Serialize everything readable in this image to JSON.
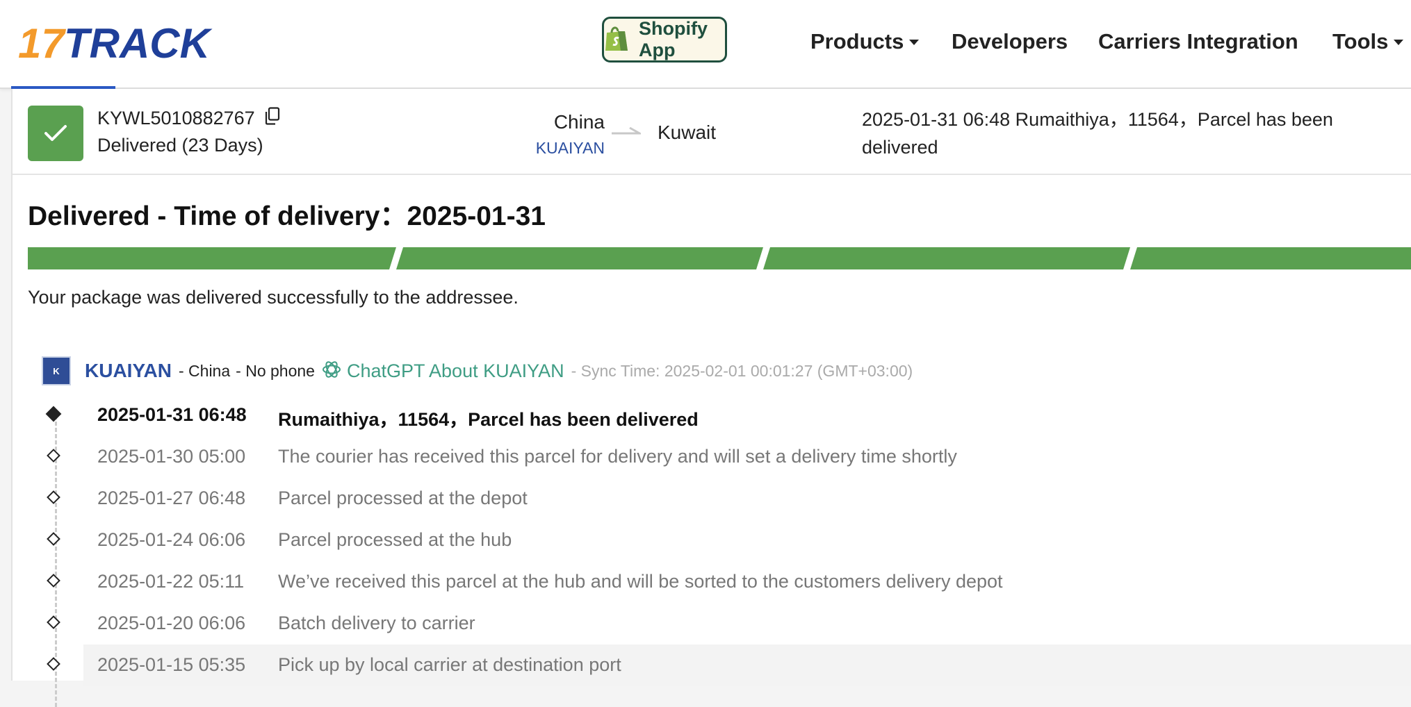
{
  "brand": {
    "logo_prefix": "17",
    "logo_suffix": "TRACK",
    "accent": "#2b4fa0",
    "orange": "#f39a2b"
  },
  "nav": {
    "shopify_label": "Shopify App",
    "items": [
      {
        "label": "Products",
        "dropdown": true
      },
      {
        "label": "Developers",
        "dropdown": false
      },
      {
        "label": "Carriers Integration",
        "dropdown": false
      },
      {
        "label": "Tools",
        "dropdown": true
      }
    ]
  },
  "summary": {
    "tracking_number": "KYWL5010882767",
    "status_days": "Delivered (23 Days)",
    "origin": "China",
    "carrier": "KUAIYAN",
    "destination": "Kuwait",
    "latest_event": "2025-01-31 06:48  Rumaithiya，11564，Parcel has been delivered",
    "status_color": "#5aa050"
  },
  "delivery": {
    "title": "Delivered - Time of delivery：2025-01-31",
    "message": "Your package was delivered successfully to the addressee.",
    "progress_segments_completed": 4,
    "progress_color": "#5aa050"
  },
  "carrier_info": {
    "name": "KUAIYAN",
    "country": "- China",
    "phone": "- No phone",
    "chatgpt_label": "ChatGPT About KUAIYAN",
    "sync_time": "- Sync Time: 2025-02-01 00:01:27 (GMT+03:00)"
  },
  "events": [
    {
      "time": "2025-01-31 06:48",
      "desc": "Rumaithiya，11564，Parcel has been delivered"
    },
    {
      "time": "2025-01-30 05:00",
      "desc": "The courier has received this parcel for delivery and will set a delivery time shortly"
    },
    {
      "time": "2025-01-27 06:48",
      "desc": "Parcel processed at the depot"
    },
    {
      "time": "2025-01-24 06:06",
      "desc": "Parcel processed at the hub"
    },
    {
      "time": "2025-01-22 05:11",
      "desc": "We’ve received this parcel at the hub and will be sorted to the customers delivery depot"
    },
    {
      "time": "2025-01-20 06:06",
      "desc": "Batch delivery to carrier"
    },
    {
      "time": "2025-01-15 05:35",
      "desc": "Pick up by local carrier at destination port"
    }
  ]
}
